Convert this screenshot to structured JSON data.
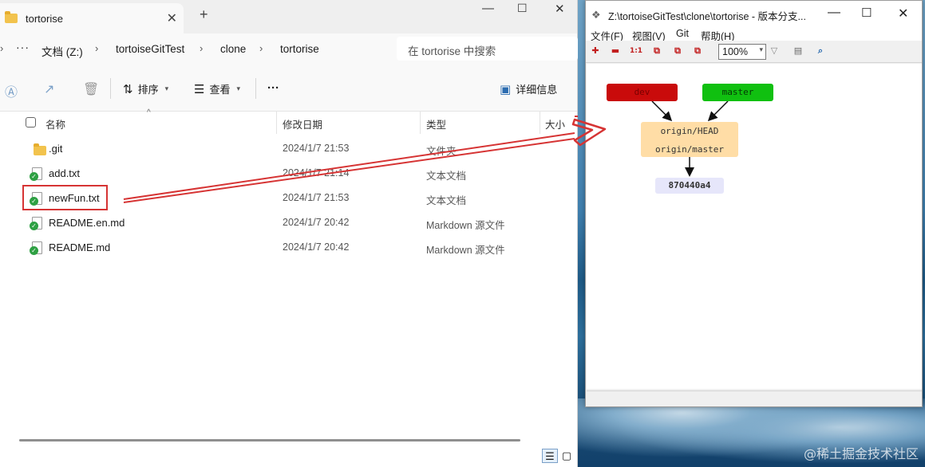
{
  "explorer": {
    "tab_title": "tortorise",
    "tab_close": "✕",
    "tab_new": "+",
    "breadcrumb": {
      "more": "···",
      "items": [
        "文档 (Z:)",
        "tortoiseGitTest",
        "clone",
        "tortorise"
      ],
      "separator": "›"
    },
    "search_placeholder": "在 tortorise 中搜索",
    "toolbar": {
      "sort_label": "排序",
      "view_label": "查看",
      "more_label": "···",
      "details_label": "详细信息"
    },
    "columns": {
      "name": "名称",
      "modified": "修改日期",
      "type": "类型",
      "size": "大小"
    },
    "files": [
      {
        "name": ".git",
        "modified": "2024/1/7 21:53",
        "type": "文件夹",
        "kind": "folder"
      },
      {
        "name": "add.txt",
        "modified": "2024/1/7 21:14",
        "type": "文本文档",
        "kind": "tgit-file"
      },
      {
        "name": "newFun.txt",
        "modified": "2024/1/7 21:53",
        "type": "文本文档",
        "kind": "tgit-file"
      },
      {
        "name": "README.en.md",
        "modified": "2024/1/7 20:42",
        "type": "Markdown 源文件",
        "kind": "tgit-file"
      },
      {
        "name": "README.md",
        "modified": "2024/1/7 20:42",
        "type": "Markdown 源文件",
        "kind": "tgit-file"
      }
    ]
  },
  "tortoisegit": {
    "title": "Z:\\tortoiseGitTest\\clone\\tortorise - 版本分支...",
    "menu": [
      "文件(F)",
      "视图(V)",
      "Git",
      "帮助(H)"
    ],
    "zoom": "100%",
    "graph": {
      "branch_dev": "dev",
      "branch_master": "master",
      "remote_head": "origin/HEAD",
      "remote_master": "origin/master",
      "commit_hash": "870440a4"
    },
    "colors": {
      "dev": "#c90b0b",
      "master": "#10c010",
      "remote": "#ffdda6",
      "commit": "#e6e6fa"
    }
  },
  "annotation": {
    "arrow_color": "#d63434"
  },
  "watermark": "@稀土掘金技术社区"
}
